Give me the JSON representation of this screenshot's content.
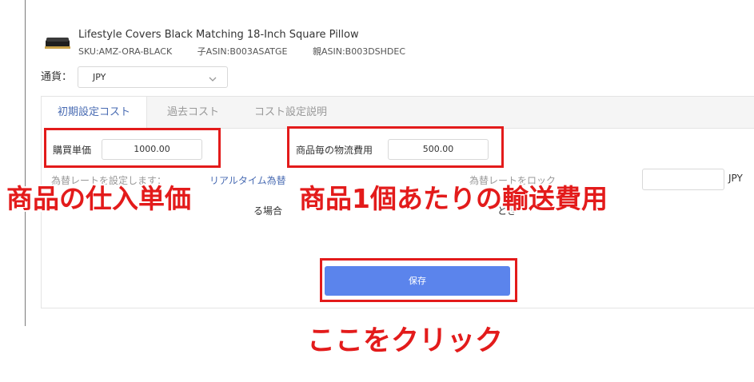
{
  "product": {
    "title": "Lifestyle Covers Black Matching 18-Inch Square Pillow",
    "sku": "SKU:AMZ-ORA-BLACK",
    "child_asin": "子ASIN:B003ASATGE",
    "parent_asin": "親ASIN:B003DSHDEC"
  },
  "currency": {
    "label": "通貨：",
    "value": "JPY"
  },
  "tabs": [
    {
      "label": "初期設定コスト"
    },
    {
      "label": "過去コスト"
    },
    {
      "label": "コスト設定説明"
    }
  ],
  "form": {
    "purchase_price_label": "購買単価",
    "purchase_price_value": "1000.00",
    "shipping_cost_label": "商品毎の物流費用",
    "shipping_cost_value": "500.00",
    "rate_unit": "JPY",
    "partial_text_1": "為替レートを設定します：",
    "partial_text_2": "リアルタイム為替",
    "partial_text_3": "為替レートをロック",
    "partial_text_4": "る場合",
    "partial_text_5": "とき"
  },
  "save_button_label": "保存",
  "annotations": {
    "unit_price": "商品の仕入単価",
    "shipping": "商品1個あたりの輸送費用",
    "click_here": "ここをクリック"
  },
  "colors": {
    "accent_blue": "#5b84ec",
    "tab_active": "#4a6cb3",
    "annotation_red": "#e31b1b"
  }
}
